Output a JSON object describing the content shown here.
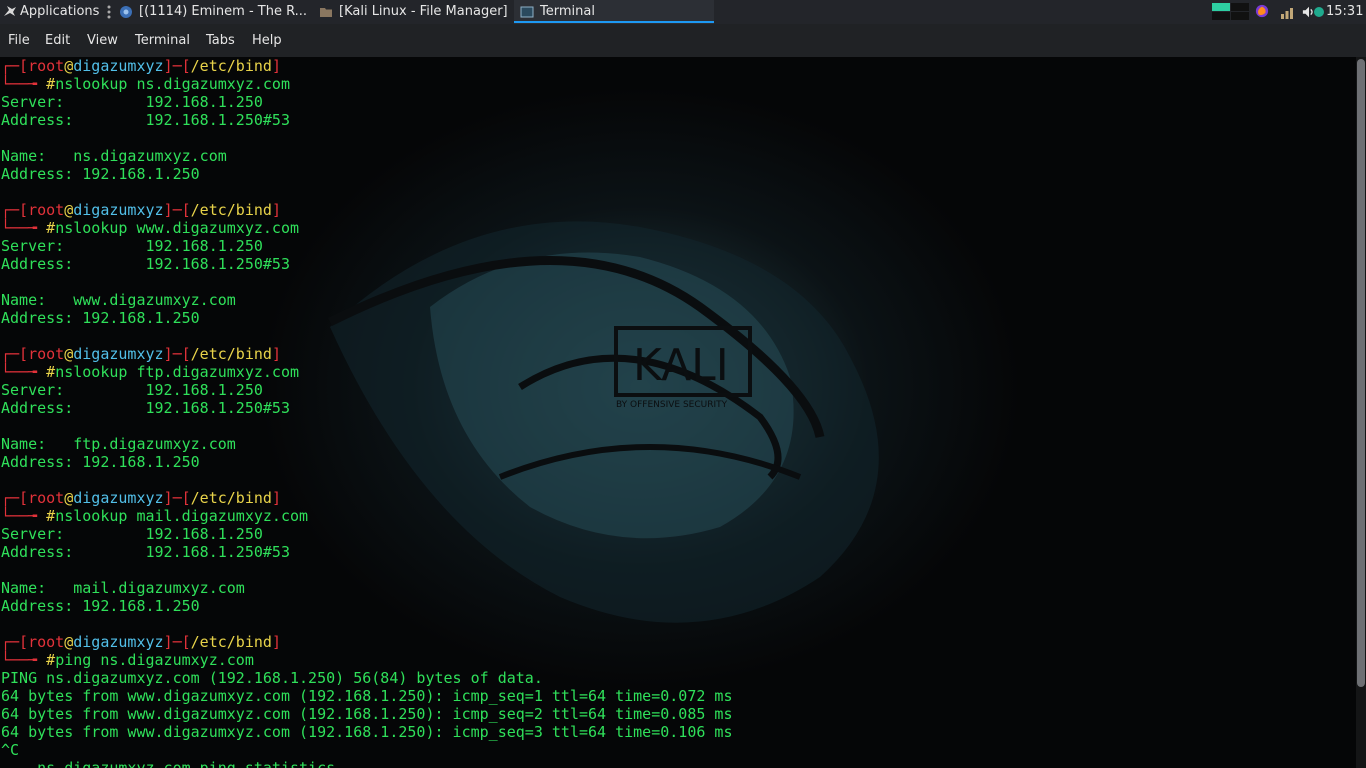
{
  "panel": {
    "applications_label": "Applications",
    "tasks": [
      {
        "label": "[(1114) Eminem - The R..."
      },
      {
        "label": "[Kali Linux - File Manager]"
      },
      {
        "label": "Terminal"
      }
    ],
    "clock": "15:31"
  },
  "menubar": [
    "File",
    "Edit",
    "View",
    "Terminal",
    "Tabs",
    "Help"
  ],
  "wallpaper": {
    "logo_text": "KALI",
    "logo_sub": "BY OFFENSIVE SECURITY"
  },
  "prompt": {
    "corner": "┌─",
    "arrow": "└──╼ ",
    "open": "[",
    "user": "root",
    "at": "@",
    "host": "digazumxyz",
    "close": "]",
    "dash": "─",
    "path": "/etc/bind",
    "hash": "#"
  },
  "terminal": {
    "commands": [
      "nslookup ns.digazumxyz.com",
      "nslookup www.digazumxyz.com",
      "nslookup ftp.digazumxyz.com",
      "nslookup mail.digazumxyz.com",
      "ping ns.digazumxyz.com"
    ],
    "outputs": [
      [
        "Server:\t\t192.168.1.250",
        "Address:\t192.168.1.250#53",
        "",
        "Name:\tns.digazumxyz.com",
        "Address: 192.168.1.250",
        ""
      ],
      [
        "Server:\t\t192.168.1.250",
        "Address:\t192.168.1.250#53",
        "",
        "Name:\twww.digazumxyz.com",
        "Address: 192.168.1.250",
        ""
      ],
      [
        "Server:\t\t192.168.1.250",
        "Address:\t192.168.1.250#53",
        "",
        "Name:\tftp.digazumxyz.com",
        "Address: 192.168.1.250",
        ""
      ],
      [
        "Server:\t\t192.168.1.250",
        "Address:\t192.168.1.250#53",
        "",
        "Name:\tmail.digazumxyz.com",
        "Address: 192.168.1.250",
        ""
      ],
      [
        "PING ns.digazumxyz.com (192.168.1.250) 56(84) bytes of data.",
        "64 bytes from www.digazumxyz.com (192.168.1.250): icmp_seq=1 ttl=64 time=0.072 ms",
        "64 bytes from www.digazumxyz.com (192.168.1.250): icmp_seq=2 ttl=64 time=0.085 ms",
        "64 bytes from www.digazumxyz.com (192.168.1.250): icmp_seq=3 ttl=64 time=0.106 ms",
        "^C",
        "--- ns.digazumxyz.com ping statistics ---"
      ]
    ]
  },
  "colors": {
    "output": "#2fe05a",
    "prompt_bracket": "#e2323a",
    "host": "#52bfe8",
    "path": "#e8d34a",
    "accent": "#1d99f3"
  }
}
